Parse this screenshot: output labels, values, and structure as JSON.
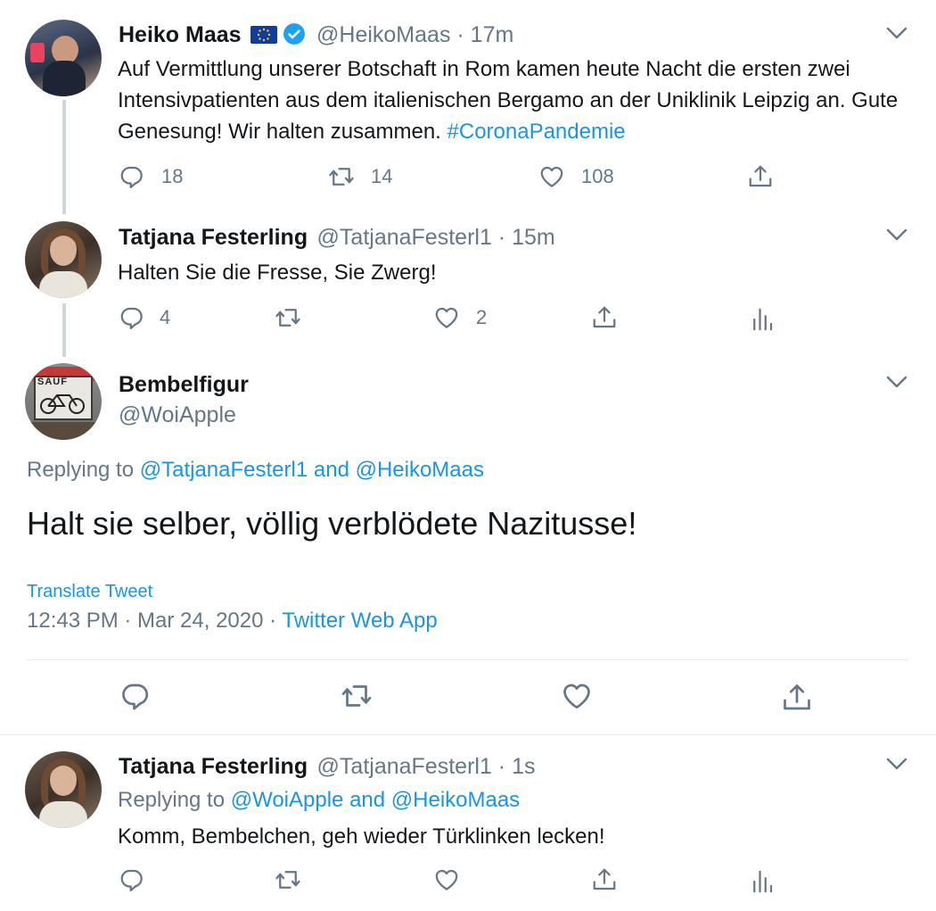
{
  "tweets": [
    {
      "name": "Heiko Maas",
      "handle": "@HeikoMaas · 17m",
      "text": "Auf Vermittlung unserer Botschaft in Rom kamen heute Nacht die ersten zwei Intensivpatienten aus dem italienischen Bergamo an der Uniklinik Leipzig an. Gute Genesung! Wir halten zusammen.",
      "hashtag": "#CoronaPandemie",
      "replies": "18",
      "retweets": "14",
      "likes": "108"
    },
    {
      "name": "Tatjana Festerling",
      "handle": "@TatjanaFesterl1 · 15m",
      "text": "Halten Sie die Fresse, Sie Zwerg!",
      "replies": "4",
      "likes": "2"
    }
  ],
  "main_tweet": {
    "name": "Bembelfigur",
    "handle": "@WoiApple",
    "avatar_sign": "SAUF",
    "replying_prefix": "Replying to",
    "replying_to": "@TatjanaFesterl1 and @HeikoMaas",
    "text": "Halt sie selber, völlig verblödete Nazitusse!",
    "translate": "Translate Tweet",
    "timestamp": "12:43 PM · Mar 24, 2020 ·",
    "source": "Twitter Web App"
  },
  "reply": {
    "name": "Tatjana Festerling",
    "handle": "@TatjanaFesterl1 · 1s",
    "replying_prefix": "Replying to",
    "replying_to": "@WoiApple and @HeikoMaas",
    "text": "Komm, Bembelchen, geh wieder Türklinken lecken!"
  },
  "icons": [
    "chevron-down-icon",
    "reply-icon",
    "retweet-icon",
    "like-icon",
    "share-icon",
    "analytics-icon",
    "verified-badge-icon",
    "eu-flag-icon"
  ],
  "colors": {
    "link": "#1b95e0",
    "muted": "#657786",
    "text": "#14171a",
    "line": "#ccd6dd"
  }
}
